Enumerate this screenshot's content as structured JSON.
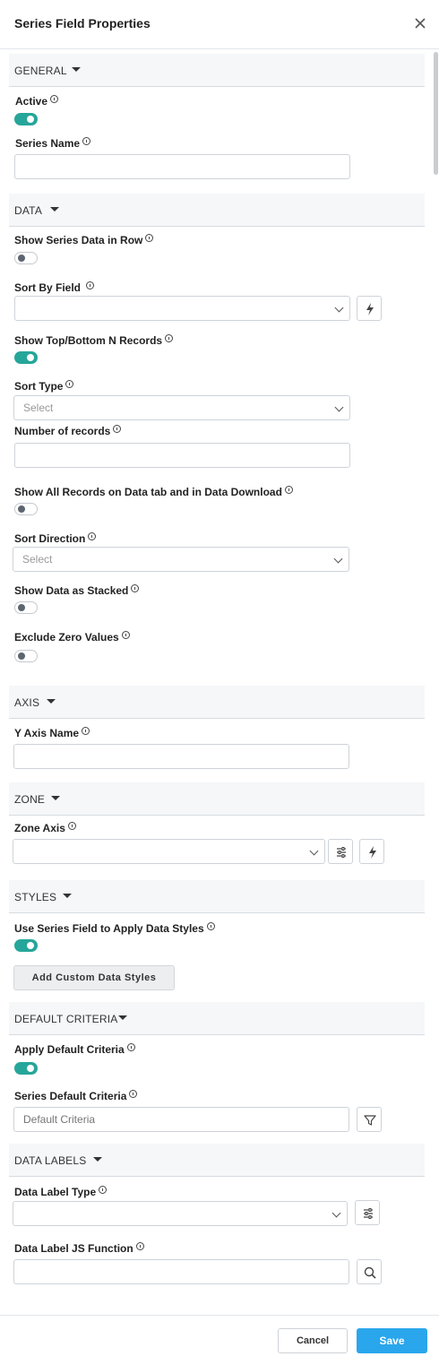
{
  "header": {
    "title": "Series Field Properties"
  },
  "sections": {
    "general": "GENERAL",
    "data": "DATA",
    "axis": "AXIS",
    "zone": "ZONE",
    "styles": "STYLES",
    "default_criteria": "DEFAULT CRITERIA",
    "data_labels": "DATA LABELS"
  },
  "fields": {
    "active": {
      "label": "Active",
      "on": true
    },
    "series_name": {
      "label": "Series Name",
      "value": ""
    },
    "show_series_data_in_row": {
      "label": "Show Series Data in Row",
      "on": false
    },
    "sort_by_field": {
      "label": "Sort By Field",
      "value": ""
    },
    "show_top_bottom": {
      "label": "Show Top/Bottom N Records",
      "on": true
    },
    "sort_type": {
      "label": "Sort Type",
      "placeholder": "Select"
    },
    "number_of_records": {
      "label": "Number of records",
      "value": ""
    },
    "show_all_records": {
      "label": "Show All Records on Data tab and in Data Download",
      "on": false
    },
    "sort_direction": {
      "label": "Sort Direction",
      "placeholder": "Select"
    },
    "show_data_stacked": {
      "label": "Show Data as Stacked",
      "on": false
    },
    "exclude_zero": {
      "label": "Exclude Zero Values",
      "on": false
    },
    "y_axis_name": {
      "label": "Y Axis Name",
      "value": ""
    },
    "zone_axis": {
      "label": "Zone Axis",
      "value": ""
    },
    "use_series_field_styles": {
      "label": "Use Series Field to Apply Data Styles",
      "on": true
    },
    "add_custom_data_styles": "Add Custom Data Styles",
    "apply_default_criteria": {
      "label": "Apply Default Criteria",
      "on": true
    },
    "series_default_criteria": {
      "label": "Series Default Criteria",
      "placeholder": "Default Criteria"
    },
    "data_label_type": {
      "label": "Data Label Type",
      "value": ""
    },
    "data_label_js_function": {
      "label": "Data Label JS Function",
      "value": ""
    }
  },
  "footer": {
    "cancel": "Cancel",
    "save": "Save"
  },
  "colors": {
    "toggle_on": "#26a69a",
    "save_button": "#2aa6ec"
  },
  "icons": [
    "close-icon",
    "info-icon",
    "chevron-down-icon",
    "lightning-icon",
    "sliders-icon",
    "filter-icon",
    "search-icon"
  ]
}
